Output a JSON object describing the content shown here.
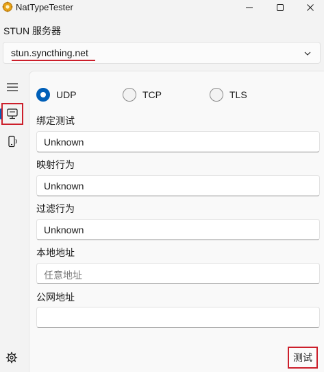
{
  "window": {
    "title": "NatTypeTester",
    "controls": [
      "minimize-icon",
      "maximize-icon",
      "close-icon"
    ]
  },
  "stun": {
    "label": "STUN 服务器",
    "value": "stun.syncthing.net"
  },
  "nav": {
    "items": [
      "menu-icon",
      "monitor-icon",
      "device-speaker-icon"
    ],
    "selected": "monitor-icon",
    "settings_icon": "gear-icon"
  },
  "protocols": {
    "options": [
      "UDP",
      "TCP",
      "TLS"
    ],
    "selected": "UDP"
  },
  "fields": {
    "binding_test": {
      "label": "绑定测试",
      "value": "Unknown"
    },
    "mapping_behavior": {
      "label": "映射行为",
      "value": "Unknown"
    },
    "filtering_behavior": {
      "label": "过滤行为",
      "value": "Unknown"
    },
    "local_address": {
      "label": "本地地址",
      "placeholder": "任意地址",
      "value": ""
    },
    "public_address": {
      "label": "公网地址",
      "value": ""
    }
  },
  "actions": {
    "test_label": "测试"
  },
  "colors": {
    "accent": "#005fb8",
    "highlight": "#cc1f2b"
  }
}
